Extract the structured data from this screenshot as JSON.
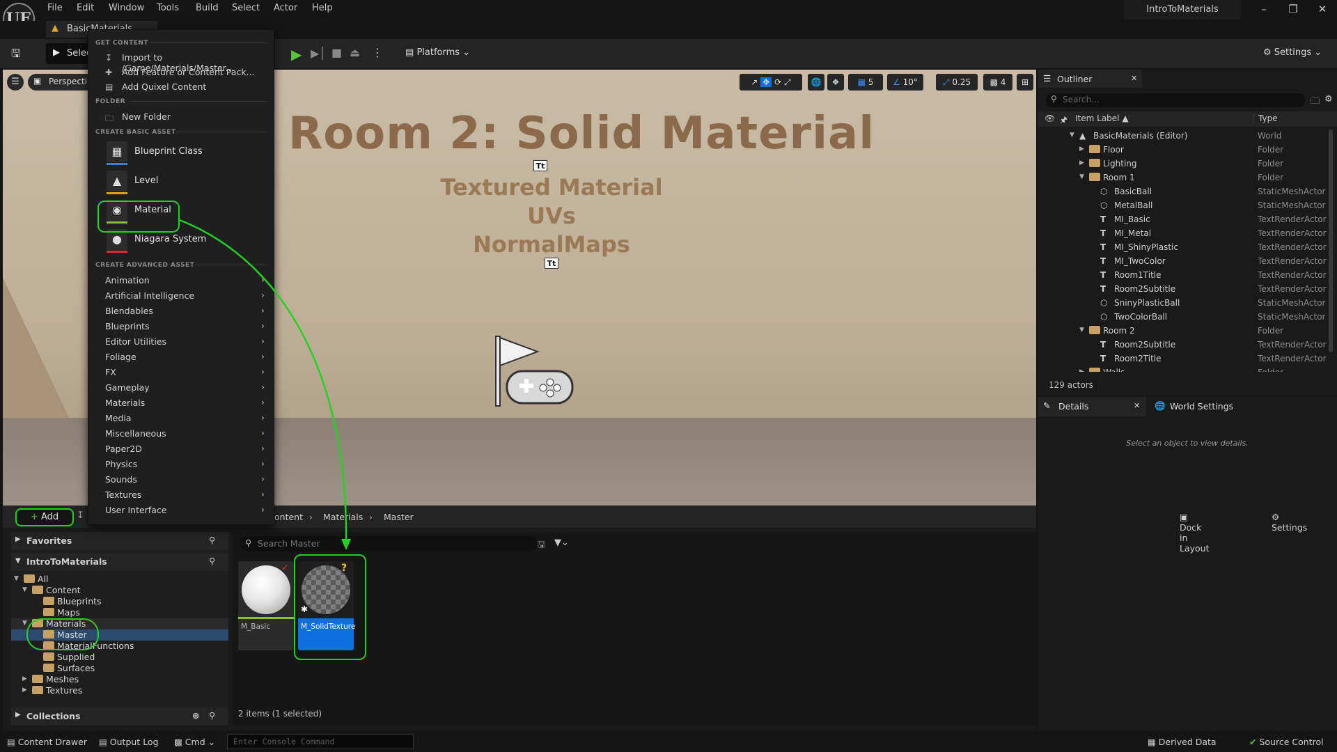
{
  "menubar": {
    "items": [
      "File",
      "Edit",
      "Window",
      "Tools",
      "Build",
      "Select",
      "Actor",
      "Help"
    ]
  },
  "app": {
    "project_name": "IntroToMaterials",
    "logo": "UE",
    "level_tab": "BasicMaterials"
  },
  "window_controls": {
    "minimize": "–",
    "restore": "❐",
    "close": "✕"
  },
  "toolbar": {
    "select_mode": "Selec",
    "platforms": "Platforms",
    "settings": "Settings"
  },
  "viewport": {
    "perspective": "Perspecti",
    "title": "Room 2: Solid Material",
    "subtitles": [
      "Textured Material",
      "UVs",
      "NormalMaps"
    ],
    "text_badge": "Tt",
    "grid_snap": "5",
    "rotation_snap": "10°",
    "scale_snap": "0.25",
    "camera_speed": "4"
  },
  "context_menu": {
    "get_content_header": "GET CONTENT",
    "get_content": [
      "Import to /Game/Materials/Master...",
      "Add Feature or Content Pack...",
      "Add Quixel Content"
    ],
    "folder_header": "FOLDER",
    "new_folder": "New Folder",
    "basic_header": "CREATE BASIC ASSET",
    "basic_assets": [
      "Blueprint Class",
      "Level",
      "Material",
      "Niagara System"
    ],
    "basic_colors": [
      "#3f7fd6",
      "#d9a21e",
      "#8bbf3a",
      "#d6312b"
    ],
    "advanced_header": "CREATE ADVANCED ASSET",
    "advanced": [
      "Animation",
      "Artificial Intelligence",
      "Blendables",
      "Blueprints",
      "Editor Utilities",
      "Foliage",
      "FX",
      "Gameplay",
      "Materials",
      "Media",
      "Miscellaneous",
      "Paper2D",
      "Physics",
      "Sounds",
      "Textures",
      "User Interface"
    ]
  },
  "outliner": {
    "tab": "Outliner",
    "search_placeholder": "Search...",
    "col_label": "Item Label ▲",
    "col_type": "Type",
    "rows": [
      {
        "label": "BasicMaterials (Editor)",
        "type": "World"
      },
      {
        "label": "Floor",
        "type": "Folder"
      },
      {
        "label": "Lighting",
        "type": "Folder"
      },
      {
        "label": "Room 1",
        "type": "Folder"
      },
      {
        "label": "BasicBall",
        "type": "StaticMeshActor"
      },
      {
        "label": "MetalBall",
        "type": "StaticMeshActor"
      },
      {
        "label": "MI_Basic",
        "type": "TextRenderActor"
      },
      {
        "label": "MI_Metal",
        "type": "TextRenderActor"
      },
      {
        "label": "MI_ShinyPlastic",
        "type": "TextRenderActor"
      },
      {
        "label": "MI_TwoColor",
        "type": "TextRenderActor"
      },
      {
        "label": "Room1Title",
        "type": "TextRenderActor"
      },
      {
        "label": "Room2Subtitle",
        "type": "TextRenderActor"
      },
      {
        "label": "SninyPlasticBall",
        "type": "StaticMeshActor"
      },
      {
        "label": "TwoColorBall",
        "type": "StaticMeshActor"
      },
      {
        "label": "Room 2",
        "type": "Folder"
      },
      {
        "label": "Room2Subtitle",
        "type": "TextRenderActor"
      },
      {
        "label": "Room2Title",
        "type": "TextRenderActor"
      },
      {
        "label": "Walls",
        "type": "Folder"
      }
    ],
    "actor_count": "129 actors"
  },
  "details": {
    "tab": "Details",
    "world_tab": "World Settings",
    "hint": "Select an object to view details."
  },
  "content_browser": {
    "add": "Add",
    "breadcrumbs": [
      "ontent",
      "Materials",
      "Master"
    ],
    "dock": "Dock in Layout",
    "settings": "Settings",
    "favorites": "Favorites",
    "project": "IntroToMaterials",
    "tree": [
      "All",
      "Content",
      "Blueprints",
      "Maps",
      "Materials",
      "Master",
      "MaterialFunctions",
      "Supplied",
      "Surfaces",
      "Meshes",
      "Textures"
    ],
    "collections": "Collections",
    "search_placeholder": "Search Master",
    "assets": [
      "M_Basic",
      "M_SolidTexture"
    ],
    "items_count": "2 items (1 selected)"
  },
  "statusbar": {
    "content_drawer": "Content Drawer",
    "output_log": "Output Log",
    "cmd": "Cmd",
    "console_placeholder": "Enter Console Command",
    "derived_data": "Derived Data",
    "source_control": "Source Control"
  },
  "colors": {
    "annotation": "#21d321",
    "selected": "#0e6fe0",
    "play": "#5cc23a"
  }
}
